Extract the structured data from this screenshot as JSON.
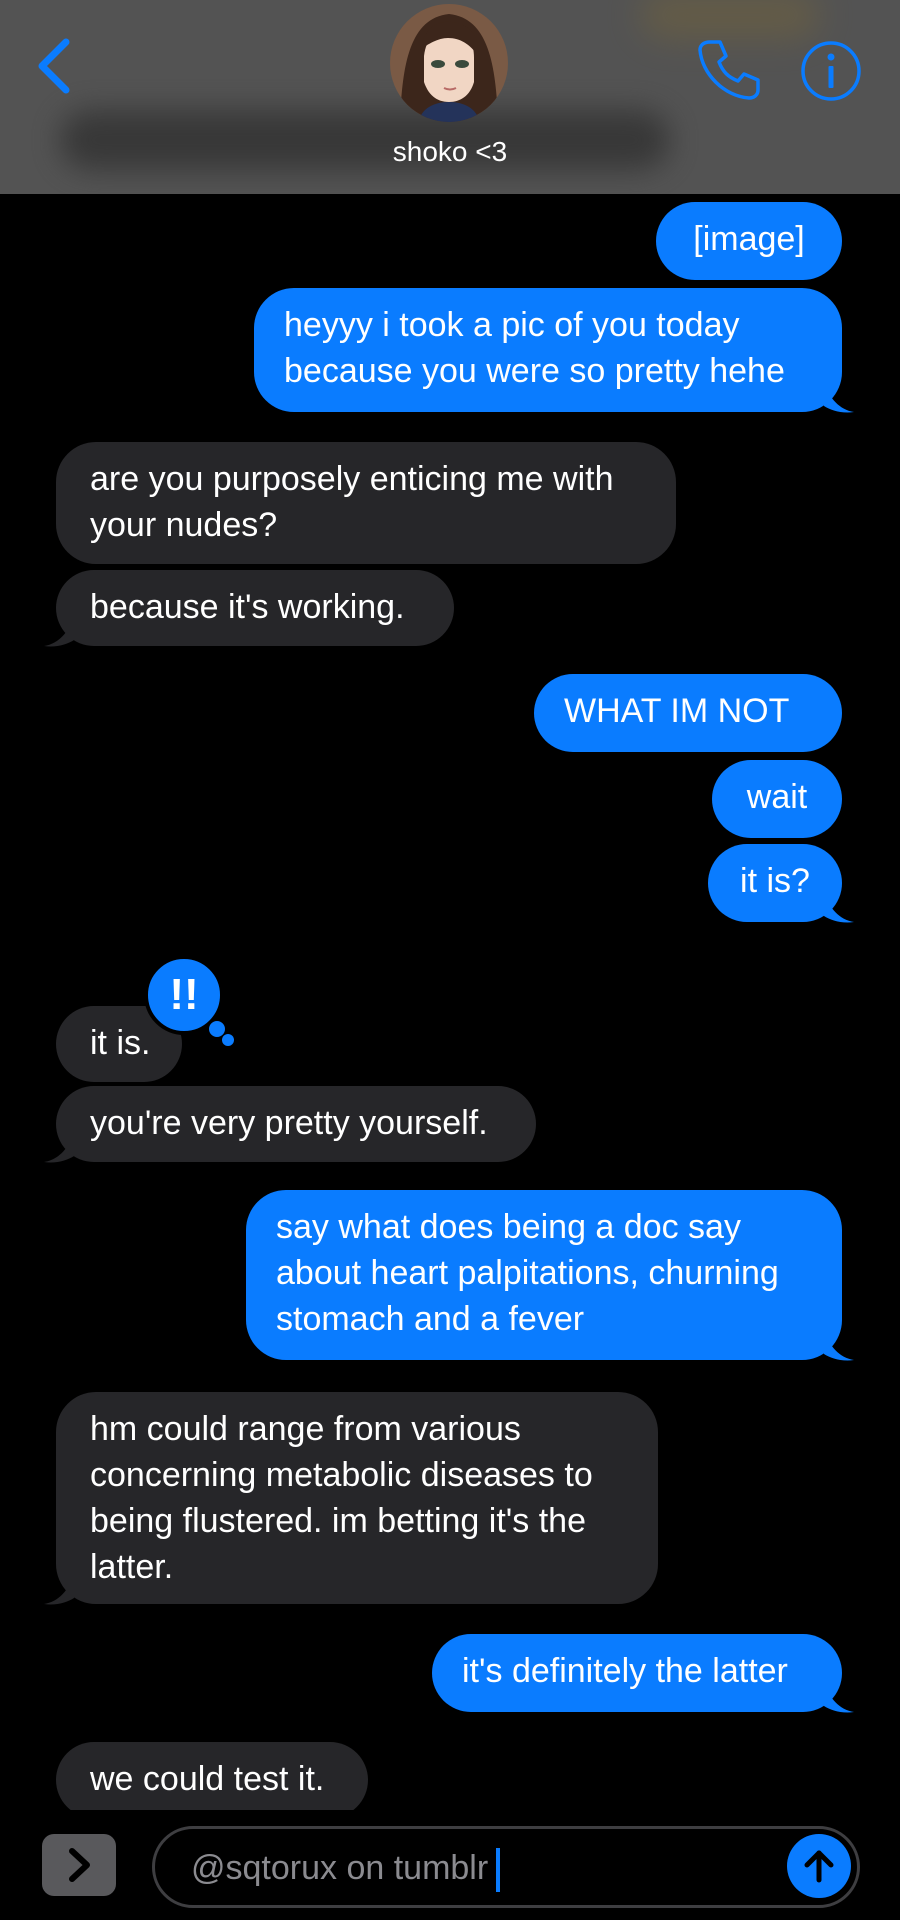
{
  "header": {
    "contact_name": "shoko <3",
    "back_icon": "chevron-left-icon",
    "call_icon": "phone-icon",
    "info_icon": "info-icon"
  },
  "messages": [
    {
      "dir": "sent",
      "text": "[image]"
    },
    {
      "dir": "sent",
      "text": "heyyy i took a pic of you today\nbecause you were so pretty hehe"
    },
    {
      "dir": "received",
      "text": "are you purposely enticing me with\nyour nudes?"
    },
    {
      "dir": "received",
      "text": "because it's working."
    },
    {
      "dir": "sent",
      "text": "WHAT IM NOT"
    },
    {
      "dir": "sent",
      "text": "wait"
    },
    {
      "dir": "sent",
      "text": "it is?"
    },
    {
      "dir": "received",
      "text": "it is.",
      "reaction": "!!"
    },
    {
      "dir": "received",
      "text": "you're very pretty yourself."
    },
    {
      "dir": "sent",
      "text": "say what does being a doc say\nabout heart palpitations, churning\nstomach and a fever"
    },
    {
      "dir": "received",
      "text": "hm could range from various\nconcerning metabolic diseases to\nbeing flustered. im betting it's the\nlatter."
    },
    {
      "dir": "sent",
      "text": "it's definitely the latter"
    },
    {
      "dir": "received",
      "text": "we could test it."
    }
  ],
  "composer": {
    "text": "@sqtorux on tumblr",
    "apps_icon": "chevron-right-icon",
    "send_icon": "arrow-up-icon"
  },
  "colors": {
    "sent_bubble": "#0a7cff",
    "received_bubble": "#262629",
    "header_bg": "#535353",
    "accent": "#0a7cff"
  }
}
